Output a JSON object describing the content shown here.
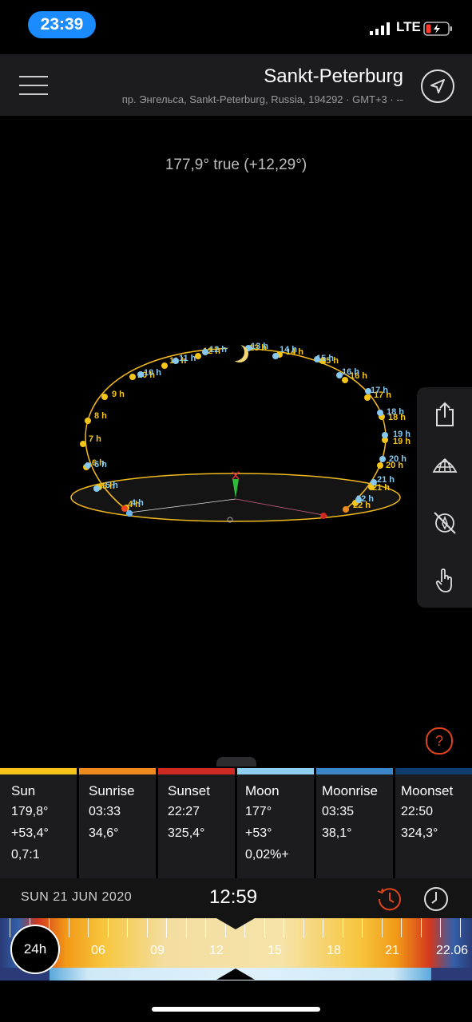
{
  "status": {
    "clock": "23:39",
    "network": "LTE"
  },
  "header": {
    "city": "Sankt-Peterburg",
    "address": "пр. Энгельса, Sankt-Peterburg, Russia, 194292 · GMT+3 · --"
  },
  "scene": {
    "bearing": "177,9° true (+12,29°)",
    "sun_hour_labels": [
      "4 h",
      "5 h",
      "6 h",
      "7 h",
      "8 h",
      "9 h",
      "10 h",
      "11 h",
      "12 h",
      "13 h",
      "14 h",
      "15 h",
      "16 h",
      "17 h",
      "18 h",
      "19 h",
      "20 h",
      "21 h",
      "22 h"
    ],
    "moon_hour_labels": [
      "4 h",
      "5 h",
      "6 h",
      "10 h",
      "11 h",
      "12 h",
      "13 h",
      "14 h",
      "15 h",
      "16 h",
      "17 h",
      "18 h",
      "19 h",
      "20 h",
      "21 h",
      "22 h"
    ]
  },
  "cards": [
    {
      "title": "Sun",
      "lines": [
        "179,8°",
        "+53,4°",
        "0,7:1"
      ],
      "color": "#f7c31a"
    },
    {
      "title": "Sunrise",
      "lines": [
        "03:33",
        "34,6°"
      ],
      "color": "#ef8a1f"
    },
    {
      "title": "Sunset",
      "lines": [
        "22:27",
        "325,4°"
      ],
      "color": "#cf2a22"
    },
    {
      "title": "Moon",
      "lines": [
        "177°",
        "+53°",
        "0,02%+"
      ],
      "color": "#8fd0f0"
    },
    {
      "title": "Moonrise",
      "lines": [
        "03:35",
        "38,1°"
      ],
      "color": "#3a86c8"
    },
    {
      "title": "Moonset",
      "lines": [
        "22:50",
        "324,3°"
      ],
      "color": "#0f3d6e"
    }
  ],
  "datetime": {
    "date": "SUN 21 JUN 2020",
    "time": "12:59"
  },
  "timeline": {
    "mode": "24h",
    "labels": [
      "06",
      "09",
      "12",
      "15",
      "18",
      "21",
      "22.06"
    ]
  },
  "colors": {
    "accent": "#e0441d",
    "sun": "#f7c31a",
    "moon": "#8fd0f0",
    "header": "#1c1c1e"
  }
}
